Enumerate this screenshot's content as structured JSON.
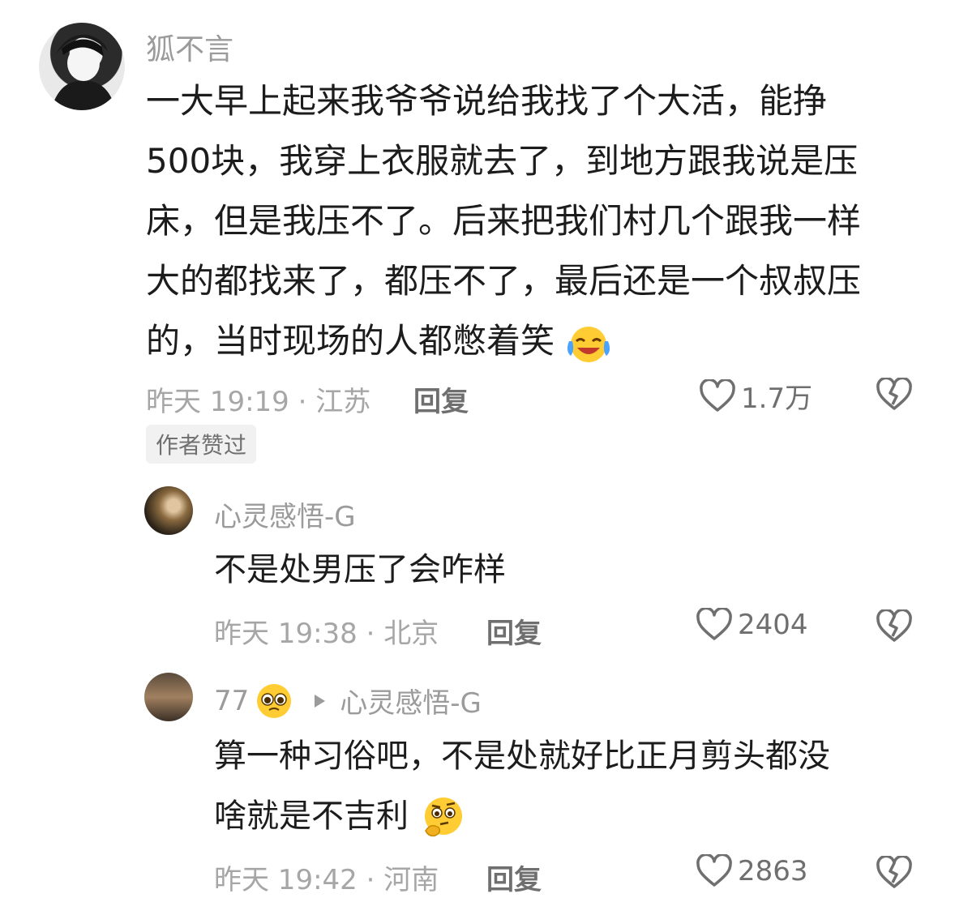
{
  "comments": [
    {
      "username": "狐不言",
      "text_lines": [
        "一大早上起来我爷爷说给我找了个大活，能挣",
        "500块，我穿上衣服就去了，到地方跟我说是压",
        "床，但是我压不了。后来把我们村几个跟我一样",
        "大的都找来了，都压不了，最后还是一个叔叔压",
        "的，当时现场的人都憋着笑"
      ],
      "emoji": "laughing-crying-emoji",
      "time_location": "昨天 19:19 · 江苏",
      "reply_label": "回复",
      "likes": "1.7万",
      "badge": "作者赞过"
    },
    {
      "username": "心灵感悟-G",
      "text_lines": [
        "不是处男压了会咋样"
      ],
      "time_location": "昨天 19:38 · 北京",
      "reply_label": "回复",
      "likes": "2404"
    },
    {
      "username": "77",
      "username_emoji": "pleading-face-emoji",
      "reply_to": "心灵感悟-G",
      "text_lines": [
        "算一种习俗吧，不是处就好比正月剪头都没",
        "啥就是不吉利"
      ],
      "emoji": "thinking-face-emoji",
      "time_location": "昨天 19:42 · 河南",
      "reply_label": "回复",
      "likes": "2863"
    }
  ]
}
